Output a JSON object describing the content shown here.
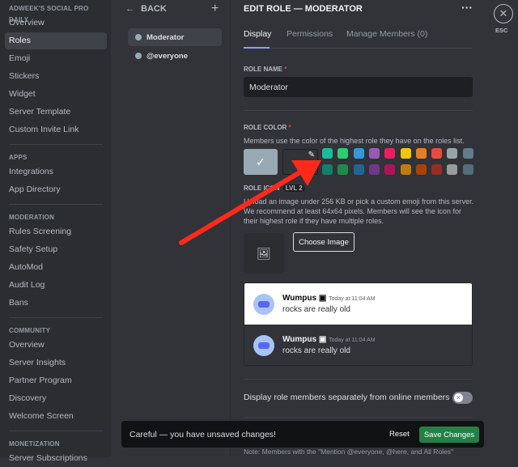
{
  "sidebar": {
    "server_title": "ADWEEK'S SOCIAL PRO DAILY",
    "items": [
      "Overview",
      "Roles",
      "Emoji",
      "Stickers",
      "Widget",
      "Server Template",
      "Custom Invite Link"
    ],
    "apps_header": "APPS",
    "apps": [
      "Integrations",
      "App Directory"
    ],
    "moderation_header": "MODERATION",
    "moderation": [
      "Rules Screening",
      "Safety Setup",
      "AutoMod",
      "Audit Log",
      "Bans"
    ],
    "community_header": "COMMUNITY",
    "community": [
      "Overview",
      "Server Insights",
      "Partner Program",
      "Discovery",
      "Welcome Screen"
    ],
    "monetization_header": "MONETIZATION",
    "monetization": [
      "Server Subscriptions"
    ]
  },
  "roles": {
    "back_label": "BACK",
    "list": [
      "Moderator",
      "@everyone"
    ]
  },
  "editor": {
    "title": "EDIT ROLE — MODERATOR",
    "tabs": [
      "Display",
      "Permissions",
      "Manage Members (0)"
    ],
    "role_name_label": "ROLE NAME",
    "role_name_value": "Moderator",
    "role_color_label": "ROLE COLOR",
    "role_color_desc": "Members use the color of the highest role they have on the roles list.",
    "selected_color": "#99aab5",
    "swatches_row1": [
      "#1abc9c",
      "#2ecc71",
      "#3498db",
      "#9b59b6",
      "#e91e63",
      "#f1c40f",
      "#e67e22",
      "#e74c3c",
      "#95a5a6",
      "#607d8b"
    ],
    "swatches_row2": [
      "#11806a",
      "#1f8b4c",
      "#206694",
      "#71368a",
      "#ad1457",
      "#c27c0e",
      "#a84300",
      "#992d22",
      "#979c9f",
      "#546e7a"
    ],
    "role_icon_label": "ROLE ICON",
    "role_icon_badge": "LVL 2",
    "role_icon_desc": "Upload an image under 256 KB or pick a custom emoji from this server. We recommend at least 64x64 pixels. Members will see the icon for their highest role if they have multiple roles.",
    "choose_image": "Choose Image",
    "preview": [
      {
        "name": "Wumpus",
        "time": "Today at 11:04 AM",
        "text": "rocks are really old"
      },
      {
        "name": "Wumpus",
        "time": "Today at 11:04 AM",
        "text": "rocks are really old"
      }
    ],
    "display_separately": "Display role members separately from online members",
    "display_separately_on": false,
    "note": "Note: Members with the \"Mention @everyone, @here, and All Roles\""
  },
  "close": {
    "label": "ESC"
  },
  "unsaved": {
    "message": "Careful — you have unsaved changes!",
    "reset": "Reset",
    "save": "Save Changes"
  },
  "colors": {
    "accent": "#5865f2",
    "save": "#248046",
    "annotation_arrow": "#ff2a1a"
  }
}
